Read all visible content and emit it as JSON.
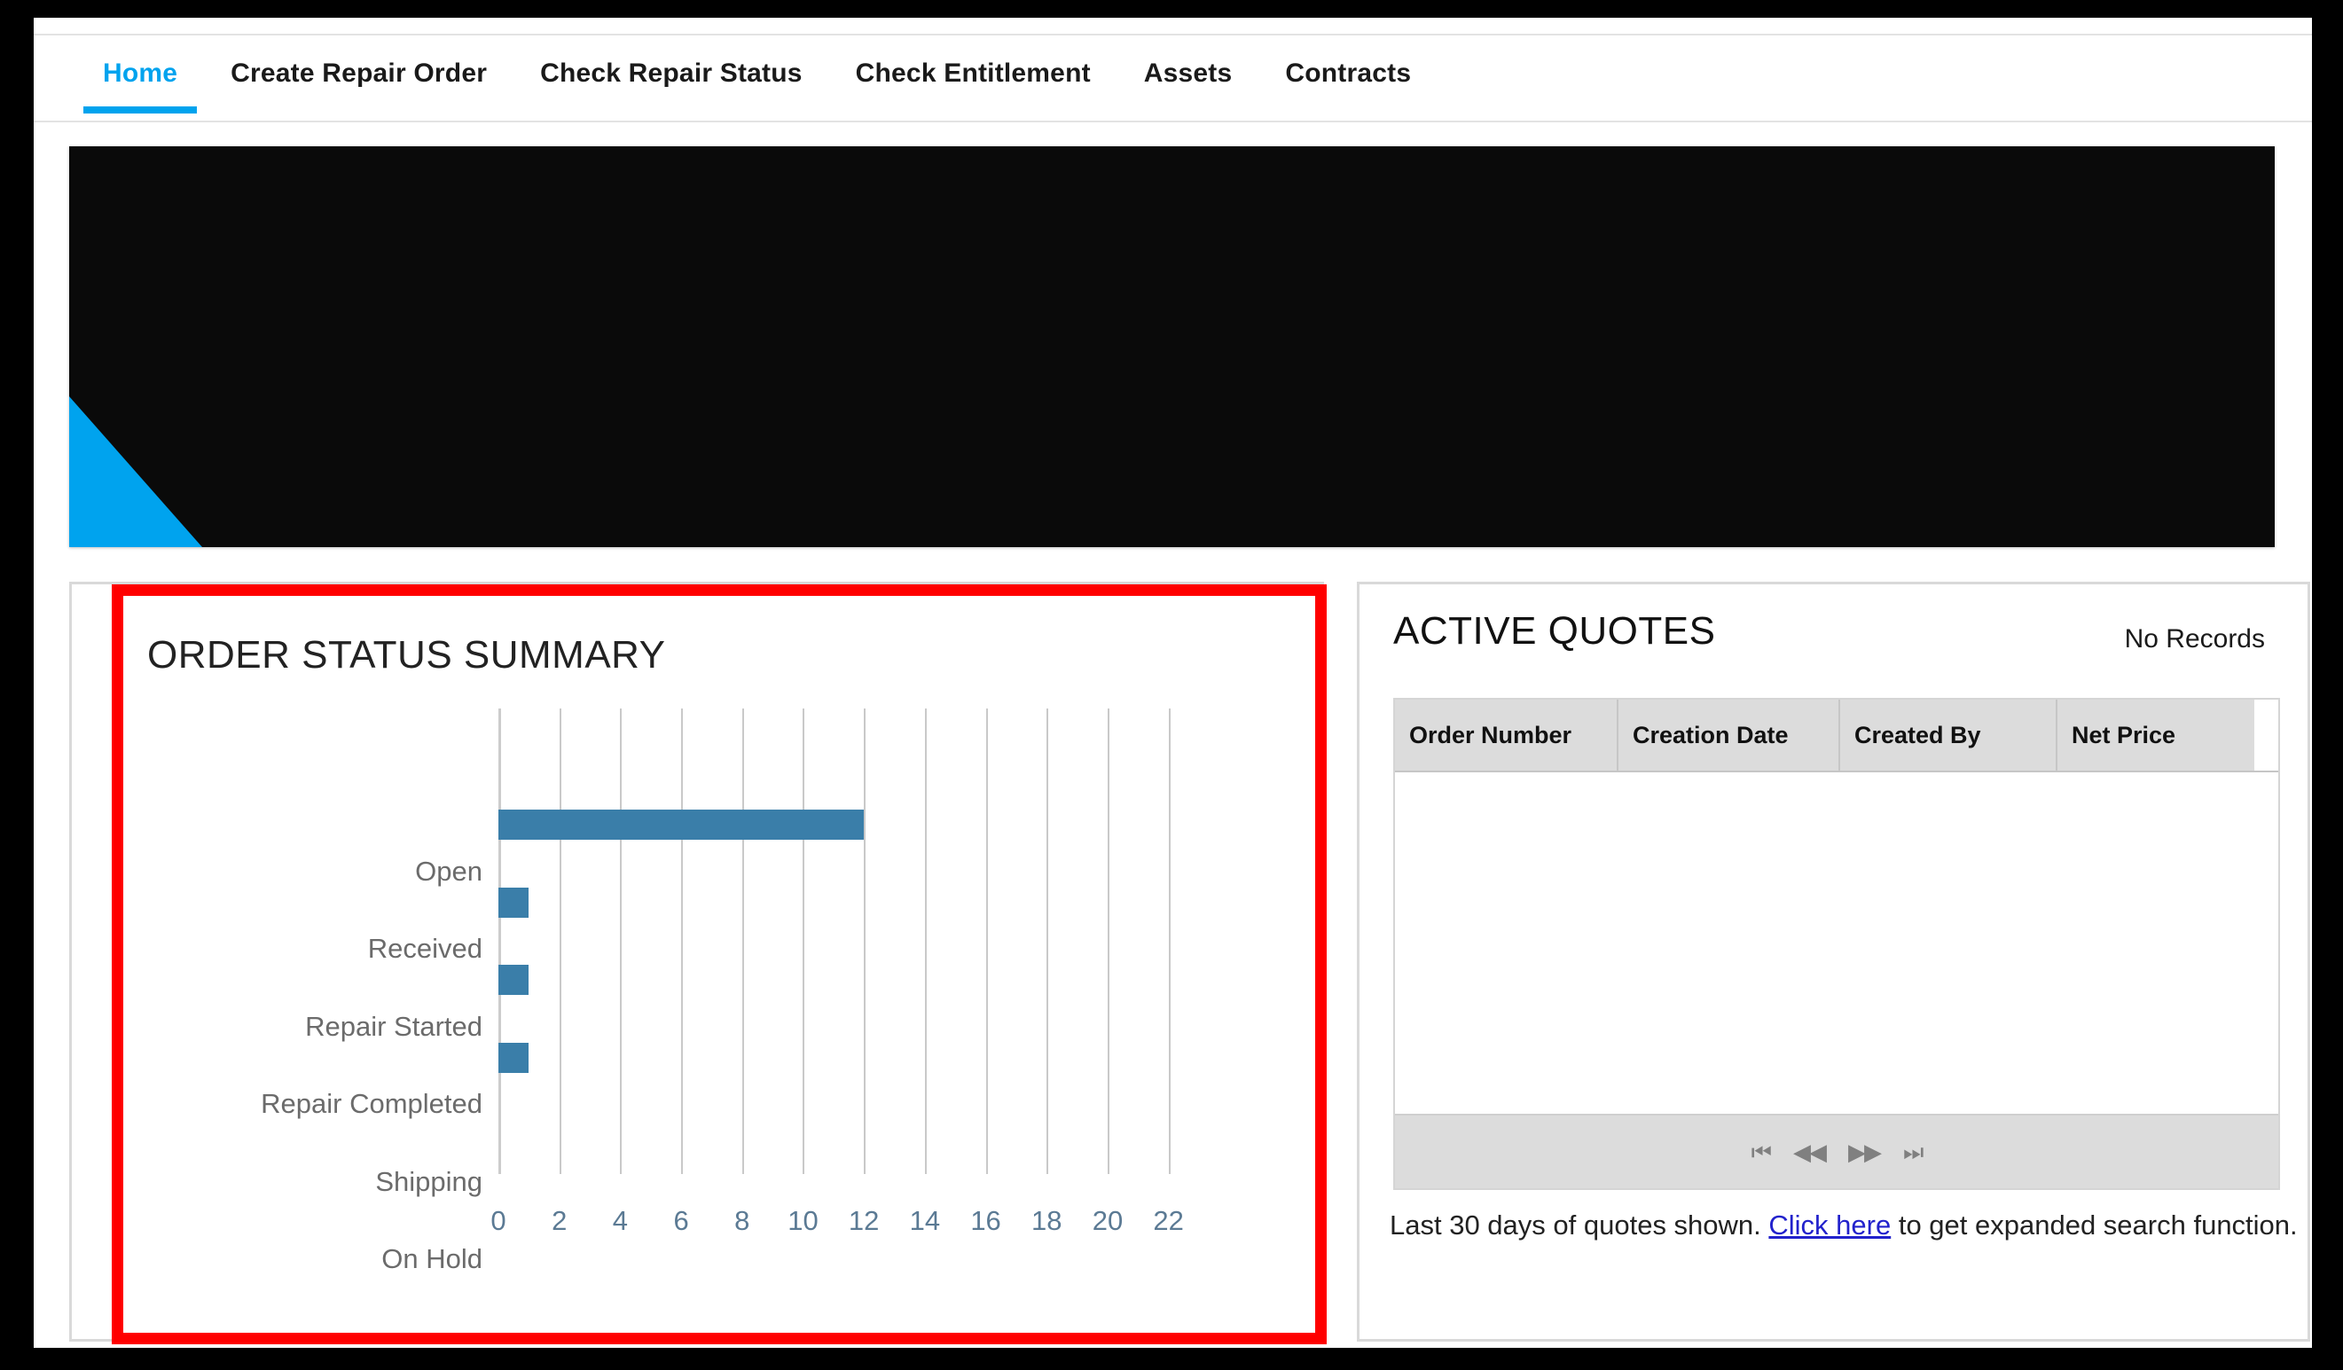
{
  "nav": {
    "items": [
      {
        "label": "Home",
        "active": true
      },
      {
        "label": "Create Repair Order",
        "active": false
      },
      {
        "label": "Check Repair Status",
        "active": false
      },
      {
        "label": "Check Entitlement",
        "active": false
      },
      {
        "label": "Assets",
        "active": false
      },
      {
        "label": "Contracts",
        "active": false
      }
    ]
  },
  "hero": {
    "background_color": "#0a0a0a",
    "accent_color": "#00a3ee"
  },
  "order_status": {
    "title": "ORDER STATUS SUMMARY",
    "highlight_color": "#ff0000"
  },
  "active_quotes": {
    "title": "ACTIVE QUOTES",
    "record_status": "No Records",
    "columns": [
      "Order Number",
      "Creation Date",
      "Created By",
      "Net Price"
    ],
    "rows": [],
    "pager": {
      "first": "⏮",
      "prev": "◀◀",
      "next": "▶▶",
      "last": "⏭"
    },
    "footnote_before": "Last 30 days of quotes shown. ",
    "footnote_link": "Click here",
    "footnote_after": " to get expanded search function."
  },
  "chart_data": {
    "type": "bar",
    "orientation": "horizontal",
    "title": "ORDER STATUS SUMMARY",
    "categories": [
      "Open",
      "Received",
      "Repair Started",
      "Repair Completed",
      "Shipping",
      "On Hold"
    ],
    "values": [
      0,
      12,
      1,
      1,
      1,
      0
    ],
    "xlabel": "",
    "ylabel": "",
    "xlim": [
      0,
      23
    ],
    "xticks": [
      0,
      2,
      4,
      6,
      8,
      10,
      12,
      14,
      16,
      18,
      20,
      22
    ],
    "gridlines": [
      0,
      2,
      4,
      6,
      8,
      10,
      12,
      14,
      16,
      18,
      20,
      22
    ],
    "grid": true,
    "legend": false,
    "bar_color": "#3a7ea9",
    "gridline_color": "#c9c9c9",
    "tick_label_color": "#5b7a94",
    "category_label_color": "#6b6b6b"
  }
}
